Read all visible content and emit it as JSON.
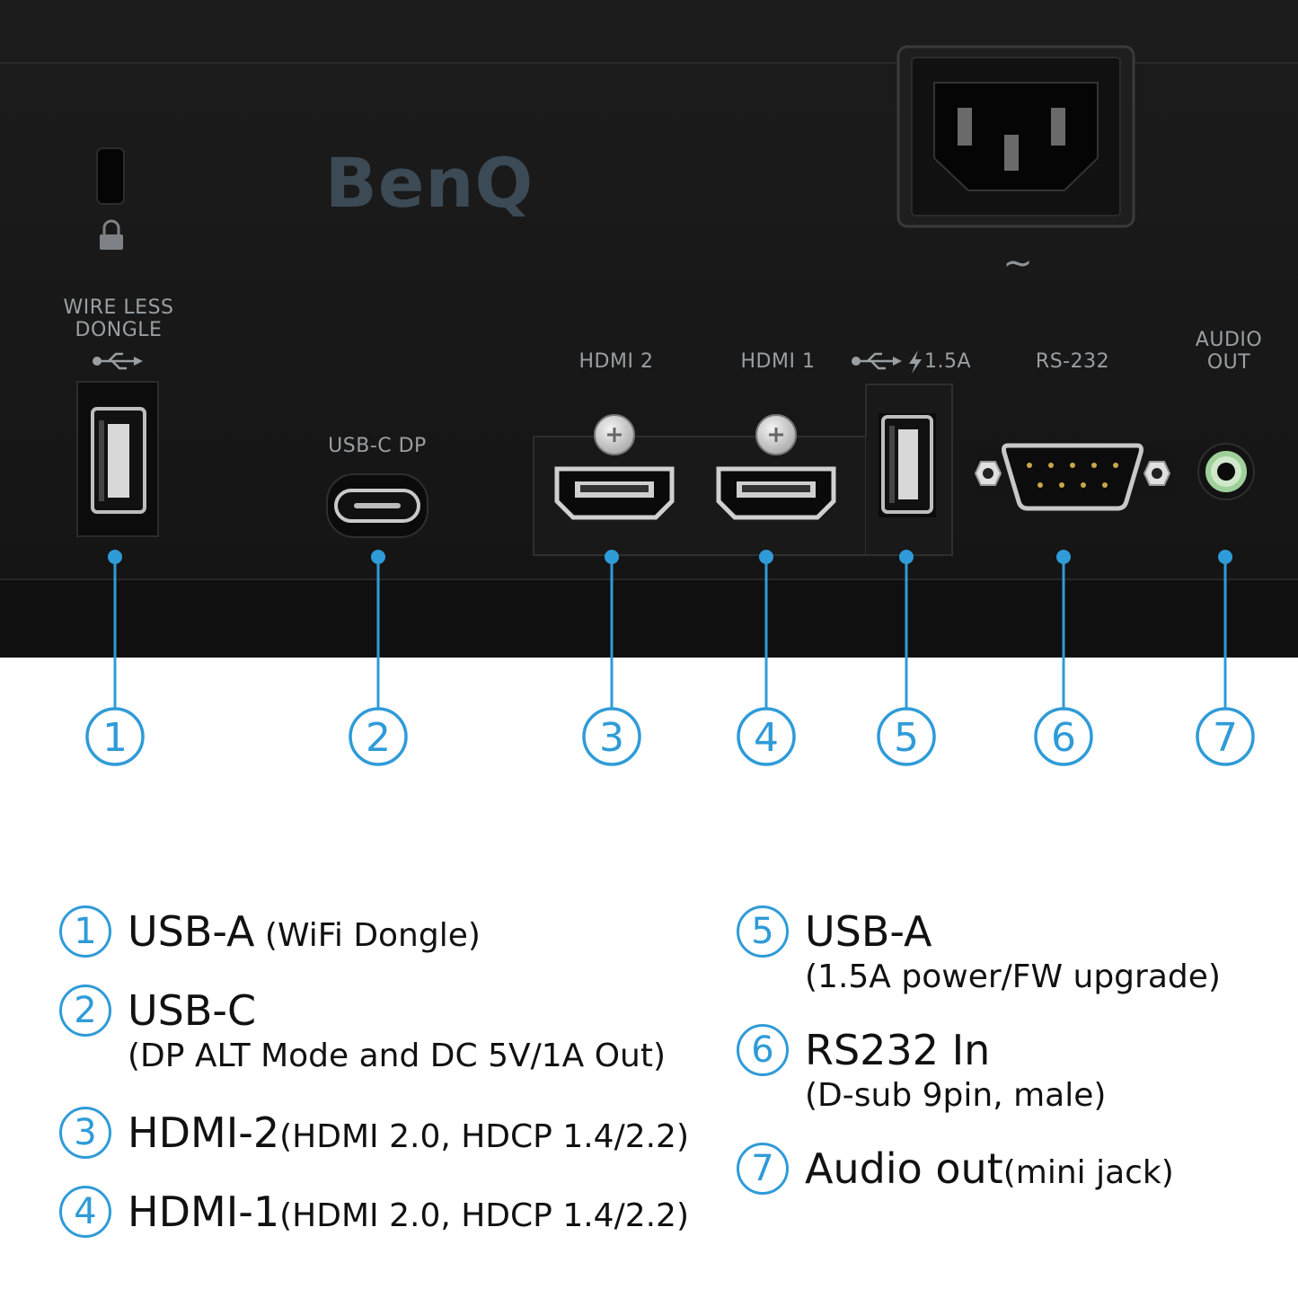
{
  "panel": {
    "brand": "BenQ",
    "power_symbol": "~",
    "labels": {
      "wireless": [
        "WIRE LESS",
        "DONGLE"
      ],
      "usbc": "USB-C DP",
      "hdmi2": "HDMI 2",
      "hdmi1": "HDMI 1",
      "usb_power": "1.5A",
      "rs232": "RS-232",
      "audio": [
        "AUDIO",
        "OUT"
      ]
    },
    "callout_numbers": [
      "1",
      "2",
      "3",
      "4",
      "5",
      "6",
      "7"
    ],
    "colors": {
      "body": "#151515",
      "accent": "#2f9bd8",
      "label": "#9a9fa3",
      "audio_ring": "#9fd09a"
    }
  },
  "legend": [
    {
      "num": "1",
      "name": "USB-A",
      "detail": " (WiFi Dongle)",
      "layout": "inline"
    },
    {
      "num": "2",
      "name": "USB-C",
      "detail": "(DP ALT Mode and DC 5V/1A Out)",
      "layout": "below"
    },
    {
      "num": "3",
      "name": "HDMI-2",
      "detail": "(HDMI 2.0, HDCP 1.4/2.2)",
      "layout": "inline"
    },
    {
      "num": "4",
      "name": "HDMI-1",
      "detail": "(HDMI 2.0, HDCP 1.4/2.2)",
      "layout": "inline"
    },
    {
      "num": "5",
      "name": "USB-A",
      "detail": "(1.5A power/FW upgrade)",
      "layout": "below"
    },
    {
      "num": "6",
      "name": "RS232 In",
      "detail": "(D-sub 9pin, male)",
      "layout": "below"
    },
    {
      "num": "7",
      "name": "Audio out",
      "detail": "(mini jack)",
      "layout": "inline"
    }
  ]
}
